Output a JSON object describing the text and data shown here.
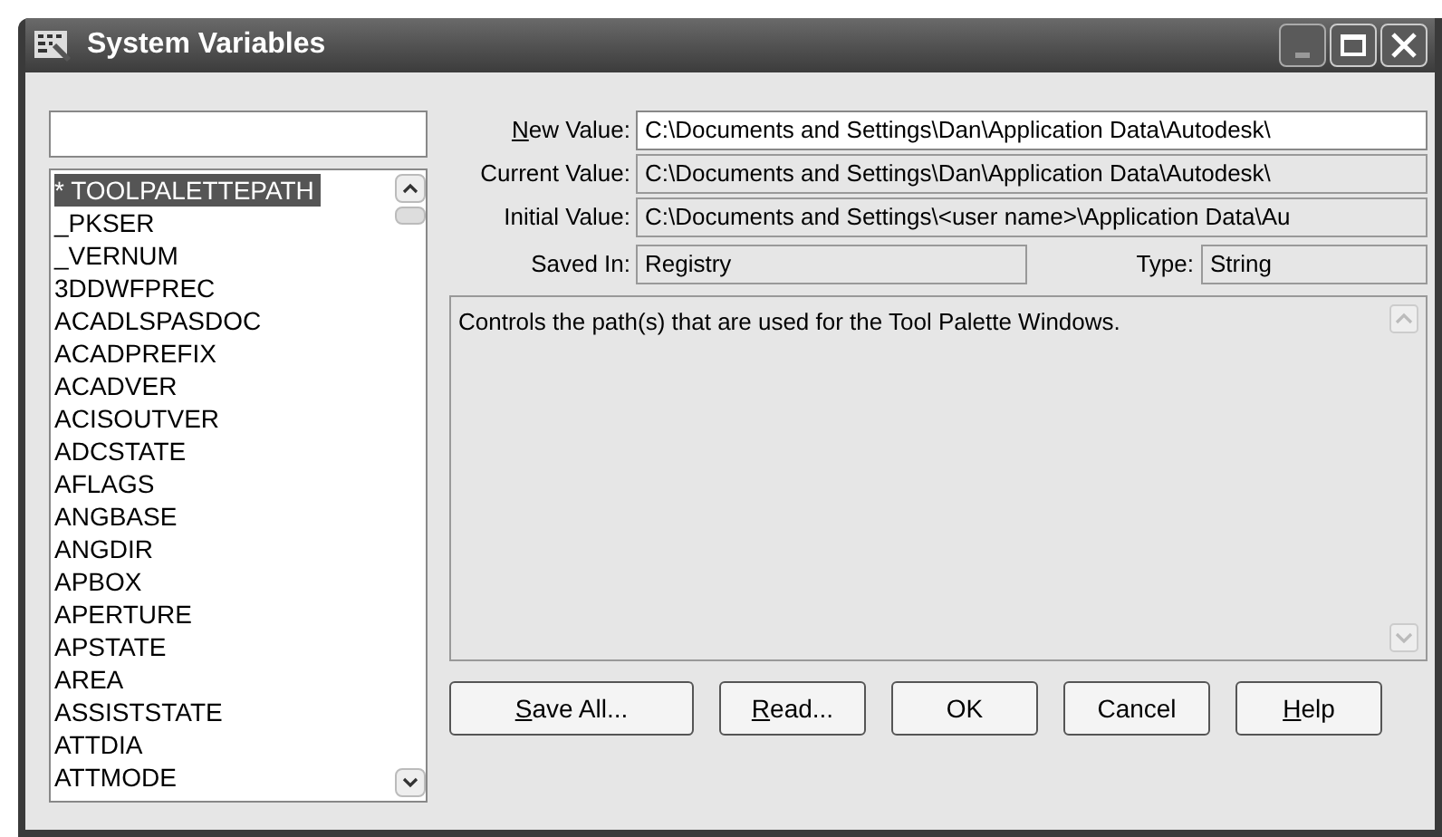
{
  "window": {
    "title": "System Variables"
  },
  "variables": [
    {
      "name": "* TOOLPALETTEPATH",
      "selected": true
    },
    {
      "name": "_PKSER",
      "selected": false
    },
    {
      "name": "_VERNUM",
      "selected": false
    },
    {
      "name": "3DDWFPREC",
      "selected": false
    },
    {
      "name": "ACADLSPASDOC",
      "selected": false
    },
    {
      "name": "ACADPREFIX",
      "selected": false
    },
    {
      "name": "ACADVER",
      "selected": false
    },
    {
      "name": "ACISOUTVER",
      "selected": false
    },
    {
      "name": "ADCSTATE",
      "selected": false
    },
    {
      "name": "AFLAGS",
      "selected": false
    },
    {
      "name": "ANGBASE",
      "selected": false
    },
    {
      "name": "ANGDIR",
      "selected": false
    },
    {
      "name": "APBOX",
      "selected": false
    },
    {
      "name": "APERTURE",
      "selected": false
    },
    {
      "name": "APSTATE",
      "selected": false
    },
    {
      "name": "AREA",
      "selected": false
    },
    {
      "name": "ASSISTSTATE",
      "selected": false
    },
    {
      "name": "ATTDIA",
      "selected": false
    },
    {
      "name": "ATTMODE",
      "selected": false
    }
  ],
  "fields": [
    {
      "label": "New Value:",
      "value": "C:\\Documents and Settings\\Dan\\Application Data\\Autodesk\\",
      "editable": true,
      "underline_first": true
    },
    {
      "label": "Current Value:",
      "value": "C:\\Documents and Settings\\Dan\\Application Data\\Autodesk\\",
      "editable": false,
      "underline_first": false
    },
    {
      "label": "Initial Value:",
      "value": "C:\\Documents and Settings\\<user name>\\Application Data\\Au",
      "editable": false,
      "underline_first": false
    }
  ],
  "saved_in": {
    "label": "Saved In:",
    "value": "Registry"
  },
  "type": {
    "label": "Type:",
    "value": "String"
  },
  "description": "Controls the path(s) that are used for the Tool Palette Windows.",
  "buttons": [
    {
      "label": "Save All...",
      "underline_first": true
    },
    {
      "label": "Read...",
      "underline_first": true
    },
    {
      "label": "OK",
      "underline_first": false
    },
    {
      "label": "Cancel",
      "underline_first": false
    },
    {
      "label": "Help",
      "underline_first": true
    }
  ]
}
